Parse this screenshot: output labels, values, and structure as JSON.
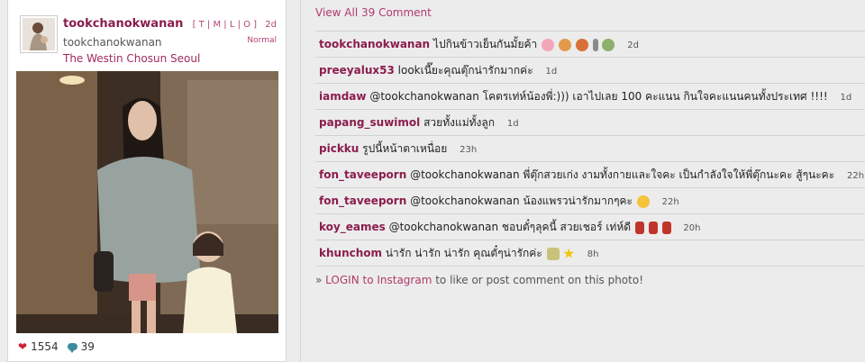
{
  "post": {
    "username": "tookchanokwanan",
    "full_name": "tookchanokwanan",
    "location": "The Westin Chosun Seoul",
    "size_links": "[ T | M | L | O ]",
    "age": "2d",
    "filter": "Normal",
    "likes": "1554",
    "comments_count": "39"
  },
  "view_all": "View All 39 Comment",
  "comments": [
    {
      "user": "tookchanokwanan",
      "text": "ไปกินข้าวเย็นกันมั้ยค้า",
      "time": "2d"
    },
    {
      "user": "preeyalux53",
      "text": "lookเนี๊ยะคุณตุ๊กน่ารักมากค่ะ",
      "time": "1d"
    },
    {
      "user": "iamdaw",
      "text": "@tookchanokwanan โคตรเท่ห์น้องพี่:))) เอาไปเลย 100 คะแนน กินใจคะแนนคนทั้งประเทศ !!!!",
      "time": "1d"
    },
    {
      "user": "papang_suwimol",
      "text": "สวยทั้งแม่ทั้งลูก",
      "time": "1d"
    },
    {
      "user": "pickku",
      "text": "รูปนี้หน้าตาเหนื่อย",
      "time": "23h"
    },
    {
      "user": "fon_taveeporn",
      "text": "@tookchanokwanan พี่ตุ๊กสวยเก่ง งามทั้งกายและใจคะ เป็นกำลังใจให้พี่ตุ๊กนะคะ สู้ๆนะคะ",
      "time": "22h"
    },
    {
      "user": "fon_taveeporn",
      "text": "@tookchanokwanan น้องแพรวน่ารักมากๆคะ",
      "time": "22h"
    },
    {
      "user": "koy_eames",
      "text": "@tookchanokwanan ชอบตั๋ๆลุคนี้ สวยเชอร์ เท่ห์ดี",
      "time": "20h"
    },
    {
      "user": "khunchom",
      "text": "น่ารัก น่ารัก น่ารัก คุณตั๋ๆน่ารักค่ะ",
      "time": "8h"
    }
  ],
  "login": {
    "prefix": "» ",
    "link": "LOGIN to Instagram",
    "suffix": " to like or post comment on this photo!"
  },
  "colors": {
    "accent": "#8b1d4d",
    "link": "#b23a6b"
  }
}
